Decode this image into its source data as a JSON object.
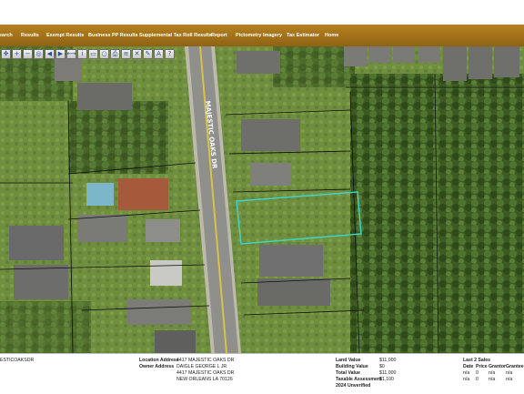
{
  "nav": {
    "items": [
      "earch",
      "Results",
      "Exempt Results",
      "Business PP Results",
      "Supplemental Tax Roll Results",
      "Report",
      "Pictometry Imagery",
      "Tax Estimator",
      "Home"
    ]
  },
  "map": {
    "street_label": "MAJESTIC OAKS DR",
    "toolbar_icons": [
      "pan-icon",
      "zoom-in-icon",
      "zoom-out-icon",
      "full-extent-icon",
      "back-icon",
      "forward-icon",
      "measure-icon",
      "identify-icon",
      "select-icon",
      "buffer-icon",
      "print-icon",
      "layers-icon",
      "clear-icon",
      "draw-icon",
      "label-icon",
      "info-icon"
    ]
  },
  "info": {
    "parcel_id_fragment": "ESTICOAKSDR",
    "location_address_label": "Location Address",
    "location_address": "4417 MAJESTIC OAKS DR",
    "owner_address_label": "Owner Address",
    "owner_name": "DAIGLE GEORGE L JR",
    "owner_street": "4417 MAJESTIC OAKS DR",
    "owner_city": "NEW ORLEANS LA 70126",
    "land_value_label": "Land Value",
    "land_value": "$11,000",
    "building_value_label": "Building Value",
    "building_value": "$0",
    "total_value_label": "Total Value",
    "total_value": "$11,000",
    "taxable_assessment_label": "Taxable Assessment",
    "taxable_assessment": "$1,100",
    "unverified_label": "2024 Unverified",
    "sales_title": "Last 2 Sales",
    "sales_headers": [
      "Date",
      "Price",
      "Grantor",
      "Grantee"
    ],
    "sales_rows": [
      [
        "n/a",
        "0",
        "n/a",
        "n/a"
      ],
      [
        "n/a",
        "0",
        "n/a",
        "n/a"
      ]
    ]
  },
  "colors": {
    "nav_bar": "#a8761c",
    "selected_parcel": "#3fd6c8",
    "parcel_lines": "#111111"
  }
}
